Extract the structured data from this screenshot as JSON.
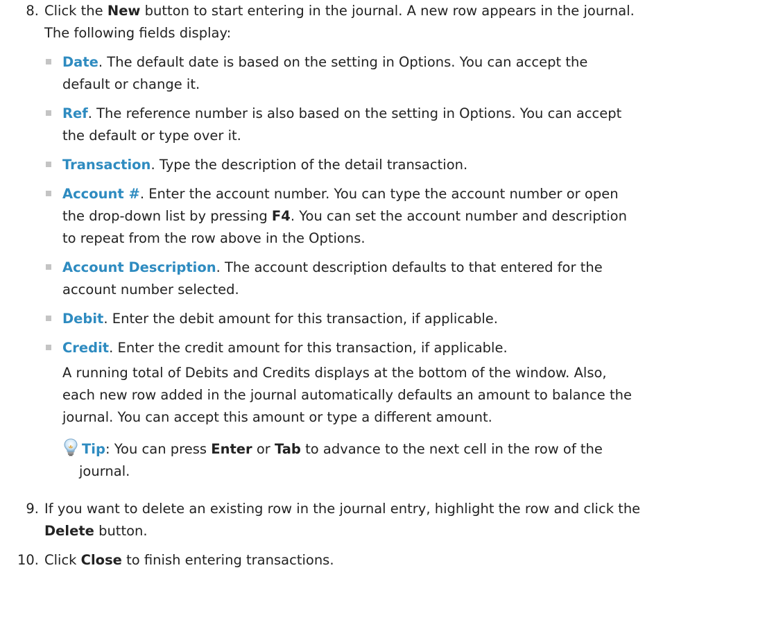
{
  "steps": [
    {
      "number": "8.",
      "intro_1": "Click the ",
      "intro_bold": "New",
      "intro_2": " button to start entering in the journal. A new row appears in the journal.",
      "intro_line2": "The following fields display:",
      "bullets": [
        {
          "term": "Date",
          "text": ". The default date is based on the setting in Options. You can accept the",
          "text2": "default or change it."
        },
        {
          "term": "Ref",
          "text": ". The reference number is also based on the setting in Options. You can accept",
          "text2": "the default or type over it."
        },
        {
          "term": "Transaction",
          "text": ". Type the description of the detail transaction."
        },
        {
          "term": "Account #",
          "text": ". Enter the account number. You can type the account number or open",
          "text2a": "the drop-down list by pressing ",
          "text2_bold": "F4",
          "text2b": ". You can set the account number and description",
          "text3": "to repeat from the row above in the Options."
        },
        {
          "term": "Account Description",
          "text": ". The account description defaults to that entered for the",
          "text2": "account number selected."
        },
        {
          "term": "Debit",
          "text": ". Enter the debit amount for this transaction, if applicable."
        },
        {
          "term": "Credit",
          "text": ". Enter the credit amount for this transaction, if applicable."
        }
      ],
      "para_1": "A running total of Debits and Credits displays at the bottom of the window. Also,",
      "para_2": "each new row added in the journal automatically defaults an amount to balance the",
      "para_3": "journal. You can accept this amount or type a different amount.",
      "tip": {
        "icon": "lightbulb-icon",
        "label": "Tip",
        "t1": ": You can press ",
        "b1": "Enter",
        "t2": " or ",
        "b2": "Tab",
        "t3": " to advance to the next cell in the row of the",
        "line2": "journal."
      }
    },
    {
      "number": "9.",
      "text": "If you want to delete an existing row in the journal entry, highlight the row and click the",
      "bold2": "Delete",
      "text2": " button."
    },
    {
      "number": "10.",
      "text1": "Click ",
      "bold": "Close",
      "text2": " to finish entering transactions."
    }
  ],
  "colors": {
    "term": "#2e8bc0",
    "text": "#222222",
    "bullet": "#c4c4c4"
  }
}
